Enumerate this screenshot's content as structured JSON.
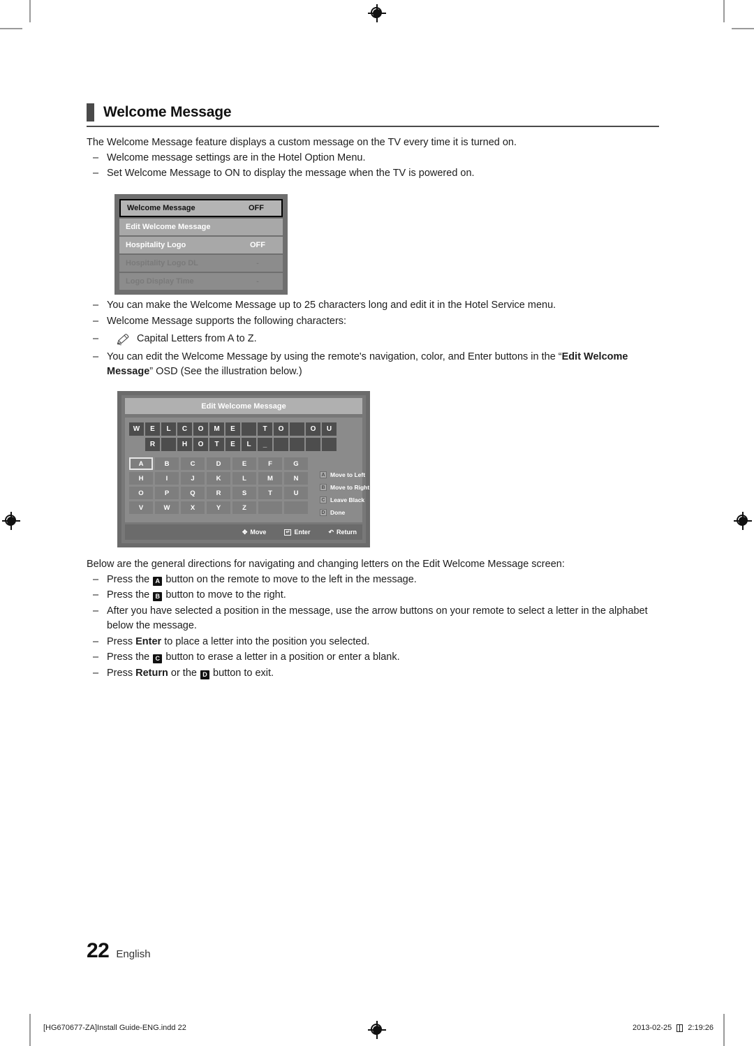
{
  "document": {
    "section_title": "Welcome Message",
    "intro": "The Welcome Message feature displays a custom message on the TV every time it is turned on.",
    "intro_bullets": [
      "Welcome message settings are in the Hotel Option Menu.",
      "Set Welcome Message to ON to display the message when the TV is powered on."
    ],
    "mid_bullets": {
      "b1": "You can make the Welcome Message up to 25 characters long and edit it in the Hotel Service menu.",
      "b2": "Welcome Message supports the following characters:",
      "note": "Capital Letters from A to Z.",
      "b3_pre": "You can edit the Welcome Message by using the remote's navigation, color, and Enter buttons in the “",
      "b3_bold": "Edit Welcome Message",
      "b3_post": "” OSD (See the illustration below.)"
    },
    "directions_intro": "Below are the general directions for navigating and changing letters on the Edit Welcome Message screen:",
    "directions": {
      "d1_pre": "Press the",
      "d1_key": "A",
      "d1_post": "button on the remote to move to the left in the message.",
      "d2_pre": "Press the",
      "d2_key": "B",
      "d2_post": "button to move to the right.",
      "d3": "After you have selected a position in the message, use the arrow buttons on your remote to select a letter in the alphabet below the message.",
      "d4_pre": "Press",
      "d4_bold": "Enter",
      "d4_post": "to place a letter into the position you selected.",
      "d5_pre": "Press the",
      "d5_key": "C",
      "d5_post": "button to erase a letter in a position or enter a blank.",
      "d6_pre": "Press",
      "d6_bold": "Return",
      "d6_mid": "or the",
      "d6_key": "D",
      "d6_post": "button to exit."
    },
    "page_number": "22",
    "language": "English",
    "print_footer": {
      "file": "[HG670677-ZA]Install Guide-ENG.indd   22",
      "date": "2013-02-25",
      "time": "2:19:26"
    }
  },
  "osd_hotel_menu": {
    "rows": [
      {
        "label": "Welcome Message",
        "value": "OFF",
        "state": "selected"
      },
      {
        "label": "Edit Welcome Message",
        "value": "",
        "state": "normal"
      },
      {
        "label": "Hospitality Logo",
        "value": "OFF",
        "state": "normal"
      },
      {
        "label": "Hospitality Logo DL",
        "value": "-",
        "state": "dim"
      },
      {
        "label": "Logo Display Time",
        "value": "-",
        "state": "dim"
      }
    ]
  },
  "osd_edit_welcome": {
    "title": "Edit Welcome Message",
    "message_row1": [
      "W",
      "E",
      "L",
      "C",
      "O",
      "M",
      "E",
      "",
      "T",
      "O",
      "",
      "O",
      "U"
    ],
    "message_row2": [
      "R",
      "",
      "H",
      "O",
      "T",
      "E",
      "L",
      "_",
      "",
      "",
      "",
      ""
    ],
    "keyboard": [
      [
        "A",
        "B",
        "C",
        "D",
        "E",
        "F",
        "G"
      ],
      [
        "H",
        "I",
        "J",
        "K",
        "L",
        "M",
        "N"
      ],
      [
        "O",
        "P",
        "Q",
        "R",
        "S",
        "T",
        "U"
      ],
      [
        "V",
        "W",
        "X",
        "Y",
        "Z",
        "",
        ""
      ]
    ],
    "selected_key": "A",
    "legend": [
      {
        "key": "A",
        "label": "Move to Left"
      },
      {
        "key": "B",
        "label": "Move to Right"
      },
      {
        "key": "C",
        "label": "Leave Black"
      },
      {
        "key": "D",
        "label": "Done"
      }
    ],
    "footer": [
      {
        "glyph": "move",
        "label": "Move"
      },
      {
        "glyph": "enter",
        "label": "Enter"
      },
      {
        "glyph": "return",
        "label": "Return"
      }
    ]
  },
  "colors": {
    "osd_bg": "#6f6f6f",
    "osd_row": "#a8a8a8",
    "osd_selected": "#b4b4b4",
    "osd_dim_text": "#7a7a7a",
    "msg_cell": "#4d4d4d",
    "key_bg": "#7e7e7e"
  }
}
